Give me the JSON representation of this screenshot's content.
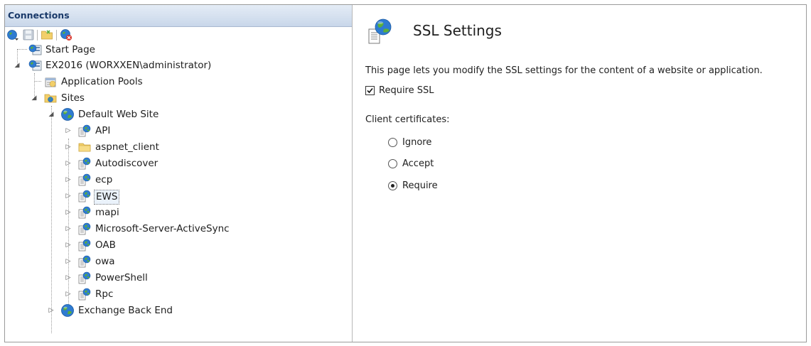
{
  "connections": {
    "header": "Connections",
    "toolbar": [
      {
        "icon": "connect-icon"
      },
      {
        "icon": "save-icon"
      },
      {
        "icon": "folder-icon"
      },
      {
        "icon": "disconnect-icon"
      }
    ],
    "tree": {
      "start_page": "Start Page",
      "server": "EX2016 (WORXXEN\\administrator)",
      "app_pools": "Application Pools",
      "sites": "Sites",
      "default_site": "Default Web Site",
      "children": [
        {
          "label": "API",
          "icon": "web-app-icon"
        },
        {
          "label": "aspnet_client",
          "icon": "folder-icon"
        },
        {
          "label": "Autodiscover",
          "icon": "web-app-icon"
        },
        {
          "label": "ecp",
          "icon": "web-app-icon"
        },
        {
          "label": "EWS",
          "icon": "web-app-icon",
          "selected": true
        },
        {
          "label": "mapi",
          "icon": "web-app-icon"
        },
        {
          "label": "Microsoft-Server-ActiveSync",
          "icon": "web-app-icon"
        },
        {
          "label": "OAB",
          "icon": "web-app-icon"
        },
        {
          "label": "owa",
          "icon": "web-app-icon"
        },
        {
          "label": "PowerShell",
          "icon": "web-app-icon"
        },
        {
          "label": "Rpc",
          "icon": "web-app-icon"
        }
      ],
      "backend_site": "Exchange Back End"
    }
  },
  "ssl": {
    "title": "SSL Settings",
    "description": "This page lets you modify the SSL settings for the content of a website or application.",
    "require_ssl_label": "Require SSL",
    "require_ssl_checked": true,
    "client_certificates_label": "Client certificates:",
    "options": [
      {
        "label": "Ignore",
        "checked": false
      },
      {
        "label": "Accept",
        "checked": false
      },
      {
        "label": "Require",
        "checked": true
      }
    ]
  },
  "colors": {
    "header_text": "#1a3a6a",
    "header_bg": "#d6e1ef",
    "globe_blue": "#2e7bd1",
    "globe_green": "#5aae3a",
    "folder_yellow": "#f2cf6a"
  }
}
